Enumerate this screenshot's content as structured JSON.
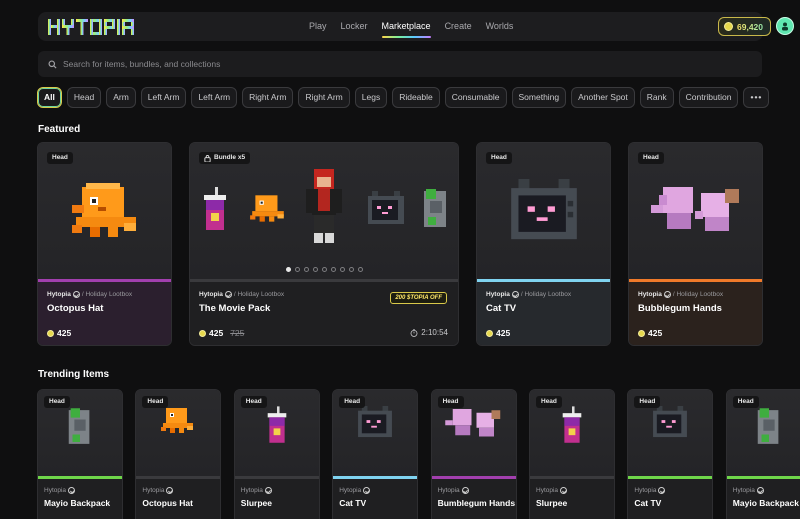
{
  "header": {
    "logo_text": "HYTOPIA",
    "nav": [
      "Play",
      "Locker",
      "Marketplace",
      "Create",
      "Worlds"
    ],
    "active_nav": "Marketplace",
    "balance": "69,420",
    "colors": {
      "accent_gold": "#d9c94a",
      "accent_green": "#6fd6a0"
    }
  },
  "search": {
    "placeholder": "Search for items, bundles, and collections",
    "value": ""
  },
  "filters": {
    "items": [
      "All",
      "Head",
      "Arm",
      "Left Arm",
      "Left Arm",
      "Right Arm",
      "Right Arm",
      "Legs",
      "Rideable",
      "Consumable",
      "Something",
      "Another Spot",
      "Rank",
      "Contribution"
    ],
    "active": "All",
    "more_label": "•••"
  },
  "featured": {
    "title": "Featured",
    "cards": [
      {
        "tag": "Head",
        "creator": "Hytopia",
        "collection": "/ Holiday Lootbox",
        "name": "Octopus Hat",
        "price": "425",
        "strip_color": "#a23fae",
        "art": "octopus-icon"
      },
      {
        "tag": "Bundle x5",
        "creator": "Hytopia",
        "collection": "/ Holiday Lootbox",
        "name": "The Movie Pack",
        "price": "425",
        "old_price": "725",
        "discount": "200 $TOPIA OFF",
        "timer": "2:10:54",
        "strip_color": "#3a3a3d",
        "carousel_dots": 9,
        "carousel_active": 0
      },
      {
        "tag": "Head",
        "creator": "Hytopia",
        "collection": "/ Holiday Lootbox",
        "name": "Cat TV",
        "price": "425",
        "strip_color": "#7fd3f0",
        "art": "cat-tv-icon"
      },
      {
        "tag": "Head",
        "creator": "Hytopia",
        "collection": "/ Holiday Lootbox",
        "name": "Bubblegum Hands",
        "price": "425",
        "strip_color": "#f07a2a",
        "art": "bubblegum-hands-icon"
      }
    ]
  },
  "trending": {
    "title": "Trending Items",
    "cards": [
      {
        "tag": "Head",
        "creator": "Hytopia",
        "name": "Mayio Backpack",
        "strip_color": "#6fd64a",
        "art": "backpack-icon"
      },
      {
        "tag": "Head",
        "creator": "Hytopia",
        "name": "Octopus Hat",
        "strip_color": "#3a3a3d",
        "art": "octopus-icon"
      },
      {
        "tag": "Head",
        "creator": "Hytopia",
        "name": "Slurpee",
        "strip_color": "#3a3a3d",
        "art": "slurpee-icon"
      },
      {
        "tag": "Head",
        "creator": "Hytopia",
        "name": "Cat TV",
        "strip_color": "#7fd3f0",
        "art": "cat-tv-icon"
      },
      {
        "tag": "Head",
        "creator": "Hytopia",
        "name": "Bumblegum Hands",
        "strip_color": "#a23fae",
        "art": "bubblegum-hands-icon"
      },
      {
        "tag": "Head",
        "creator": "Hytopia",
        "name": "Slurpee",
        "strip_color": "#3a3a3d",
        "art": "slurpee-icon"
      },
      {
        "tag": "Head",
        "creator": "Hytopia",
        "name": "Cat TV",
        "strip_color": "#6fd64a",
        "art": "cat-tv-icon"
      },
      {
        "tag": "Head",
        "creator": "Hytopia",
        "name": "Mayio Backpack",
        "strip_color": "#6fd64a",
        "art": "backpack-icon"
      }
    ]
  }
}
